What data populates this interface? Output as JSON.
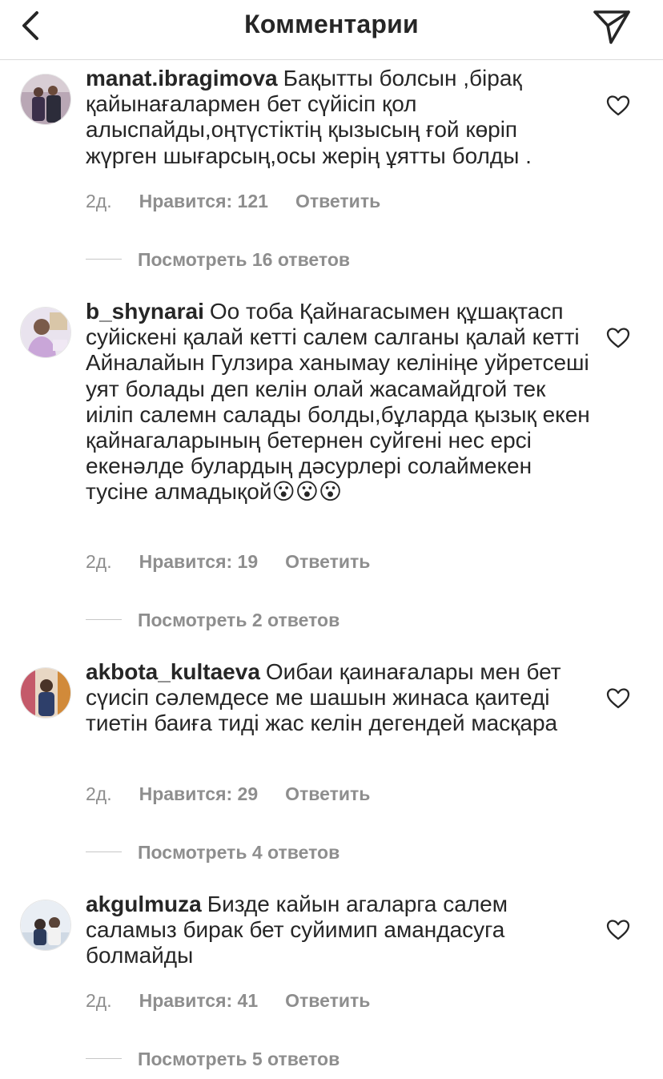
{
  "header": {
    "title": "Комментарии",
    "back_icon": "chevron-left-icon",
    "send_icon": "paper-plane-icon"
  },
  "comments": [
    {
      "username": "manat.ibragimova",
      "text": "Бақытты болсын ,бірақ қайынағалармен бет сүйісіп қол алыспайды,оңтүстіктің қызысың ғой көріп жүрген шығарсың,осы жерің ұятты болды .",
      "time": "2д.",
      "likes": "Нравится: 121",
      "reply": "Ответить",
      "view_replies": "Посмотреть 16 ответов"
    },
    {
      "username": "b_shynarai",
      "text": "Оо тоба Қайнагасымен құшақтасп суйіскені қалай кетті салем салганы қалай кетті Айналайын Гулзира ханымау келініңе уйретсеші уят болады деп келін олай жасамайдгой  тек иіліп салемн салады болды,бұларда қызық екен қайнагаларының бетернен суйгені нес ерсі екенәлде булардың дәсурлері  солаймекен тусіне алмадықой😮😮😮",
      "time": "2д.",
      "likes": "Нравится: 19",
      "reply": "Ответить",
      "view_replies": "Посмотреть 2 ответов"
    },
    {
      "username": "akbota_kultaeva",
      "text": "Оибаи қаинағалары мен бет сүисіп сәлемдесе ме  шашын жинаса қаитеді тиетін баиға тиді жас келін дегендей масқара",
      "time": "2д.",
      "likes": "Нравится: 29",
      "reply": "Ответить",
      "view_replies": "Посмотреть 4 ответов"
    },
    {
      "username": "akgulmuza",
      "text": "Бизде кайын агаларга салем саламыз бирак бет суйимип амандасуга болмайды",
      "time": "2д.",
      "likes": "Нравится: 41",
      "reply": "Ответить",
      "view_replies": "Посмотреть 5 ответов"
    }
  ],
  "colors": {
    "text": "#262626",
    "secondary": "#8e8e8e",
    "divider": "#dbdbdb"
  }
}
